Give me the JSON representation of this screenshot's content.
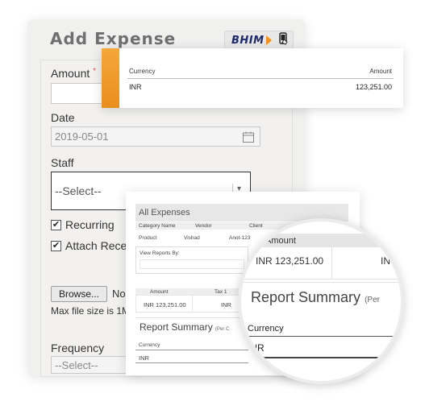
{
  "form": {
    "title": "Add Expense",
    "bhim_label": "BHIM",
    "amount_label": "Amount",
    "required_mark": "*",
    "amount_value": "",
    "date_label": "Date",
    "date_value": "2019-05-01",
    "staff_label": "Staff",
    "staff_value": "--Select--",
    "recurring_label": "Recurring",
    "attach_label": "Attach Recei",
    "browse_label": "Browse...",
    "no_file_text": "No",
    "max_file_text": "Max file size is 1M",
    "frequency_label": "Frequency",
    "frequency_value": "--Select--"
  },
  "popup": {
    "col_currency": "Currency",
    "col_amount": "Amount",
    "currency_value": "INR",
    "amount_value": "123,251.00"
  },
  "expenses": {
    "title": "All Expenses",
    "columns": [
      "Category Name",
      "Vendor",
      "Client"
    ],
    "row": [
      "Product",
      "Vishad",
      "Anot-123"
    ],
    "view_reports_label": "View Reports By:",
    "amount_header": "Amount",
    "tax_header": "Tax 1",
    "amount_value": "INR 123,251.00",
    "tax_value": "INR",
    "report_summary": "Report Summary",
    "per_text": "(Per C",
    "currency_label": "Currency",
    "currency_value": "INR"
  },
  "lens": {
    "amount_header": "Amount",
    "amount_value": "INR 123,251.00",
    "second_value": "IN",
    "report_summary": "Report Summary",
    "per_text": "(Per",
    "currency_label": "Currency",
    "currency_value": "INR"
  },
  "colors": {
    "accent": "#f29222",
    "bhim_blue": "#1c2a6b"
  }
}
